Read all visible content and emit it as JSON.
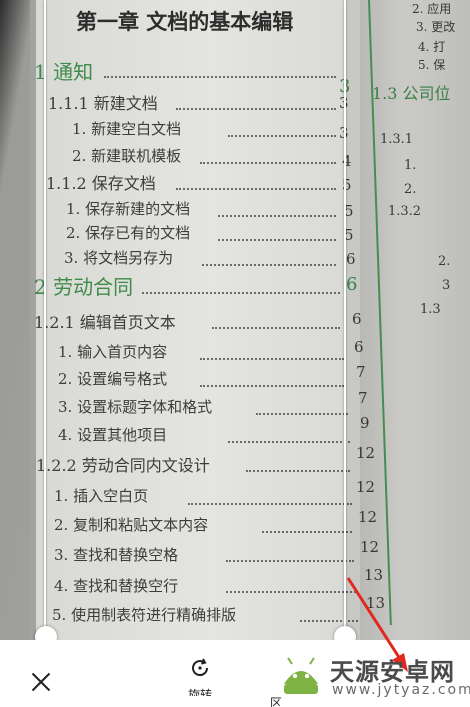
{
  "document": {
    "chapter_title": "第一章 文档的基本编辑",
    "left_page": {
      "sections": [
        {
          "label": "1 通知",
          "page": "3"
        },
        {
          "label": "1.1.1 新建文档",
          "page": "3"
        },
        {
          "label": "1. 新建空白文档",
          "page": "3"
        },
        {
          "label": "2. 新建联机模板",
          "page": "4"
        },
        {
          "label": "1.1.2 保存文档",
          "page": "5"
        },
        {
          "label": "1. 保存新建的文档",
          "page": "5"
        },
        {
          "label": "2. 保存已有的文档",
          "page": "5"
        },
        {
          "label": "3. 将文档另存为",
          "page": "6"
        },
        {
          "label": "2 劳动合同",
          "page": "6"
        },
        {
          "label": "1.2.1 编辑首页文本",
          "page": "6"
        },
        {
          "label": "1. 输入首页内容",
          "page": "6"
        },
        {
          "label": "2. 设置编号格式",
          "page": "7"
        },
        {
          "label": "3. 设置标题字体和格式",
          "page": "7"
        },
        {
          "label": "4. 设置其他项目",
          "page": "9"
        },
        {
          "label": "1.2.2 劳动合同内文设计",
          "page": "12"
        },
        {
          "label": "1. 插入空白页",
          "page": "12"
        },
        {
          "label": "2. 复制和粘贴文本内容",
          "page": "12"
        },
        {
          "label": "3. 查找和替换空格",
          "page": "12"
        },
        {
          "label": "4. 查找和替换空行",
          "page": "13"
        },
        {
          "label": "5. 使用制表符进行精确排版",
          "page": "13"
        }
      ]
    },
    "right_page": {
      "top_items": [
        "2. 应用",
        "3. 更改",
        "4. 打",
        "5. 保"
      ],
      "section_title": "1.3 公司位",
      "fragments": [
        "1.3.1",
        "1.",
        "2.",
        "1.3.2",
        "2.",
        "3",
        "1.3"
      ]
    }
  },
  "toolbar": {
    "close_label": "×",
    "rotate_label": "旋转",
    "partial_label": "区"
  },
  "watermark": {
    "title": "天源安卓网",
    "url": "www.jytyaz.com"
  },
  "colors": {
    "heading_green": "#3e8b4a",
    "arrow_red": "#e0281f",
    "toolbar_bg": "#ffffff"
  }
}
